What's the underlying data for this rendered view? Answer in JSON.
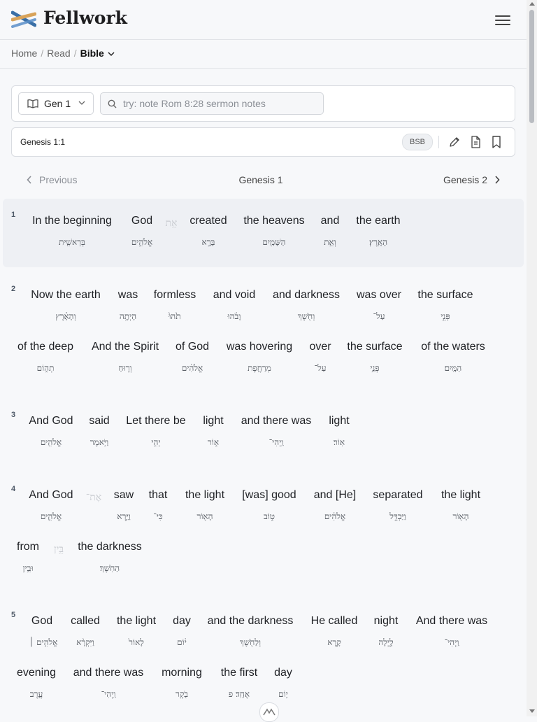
{
  "app": {
    "brand": "Fellwork"
  },
  "breadcrumb": {
    "home": "Home",
    "sep1": "/",
    "read": "Read",
    "sep2": "/",
    "current": "Bible"
  },
  "toolbar": {
    "book_selector": "Gen 1",
    "search_placeholder": "try: note Rom 8:28 sermon notes",
    "search_value": ""
  },
  "refbar": {
    "reference": "Genesis 1:1",
    "translation": "BSB"
  },
  "nav": {
    "previous": "Previous",
    "current": "Genesis 1",
    "next": "Genesis 2"
  },
  "verses": [
    {
      "num": "1",
      "words": [
        {
          "en": "In the beginning",
          "he": "בְּרֵאשִׁ֖ית"
        },
        {
          "en": "God",
          "he": "אֱלֹהִ֑ים"
        },
        {
          "en": "",
          "he": "אֵ֥ת"
        },
        {
          "en": "created",
          "he": "בָּרָ֣א"
        },
        {
          "en": "the heavens",
          "he": "הַשָּׁמַ֖יִם"
        },
        {
          "en": "and",
          "he": "וְאֵ֥ת"
        },
        {
          "en": "the earth",
          "he": "הָאָֽרֶץ׃"
        }
      ]
    },
    {
      "num": "2",
      "words": [
        {
          "en": "Now the earth",
          "he": "וְהָאָ֗רֶץ"
        },
        {
          "en": "was",
          "he": "הָיְתָ֥ה"
        },
        {
          "en": "formless",
          "he": "תֹ֙הוּ֙"
        },
        {
          "en": "and void",
          "he": "וָבֹ֔הוּ"
        },
        {
          "en": "and darkness",
          "he": "וְחֹ֖שֶׁךְ"
        },
        {
          "en": "was over",
          "he": "עַל־"
        },
        {
          "en": "the surface",
          "he": "פְּנֵ֣י"
        },
        {
          "en": "of the deep",
          "he": "תְה֑וֹם"
        },
        {
          "en": "And the Spirit",
          "he": "וְר֣וּחַ"
        },
        {
          "en": "of God",
          "he": "אֱלֹהִ֔ים"
        },
        {
          "en": "was hovering",
          "he": "מְרַחֶ֖פֶת"
        },
        {
          "en": "over",
          "he": "עַל־"
        },
        {
          "en": "the surface",
          "he": "פְּנֵ֥י"
        },
        {
          "en": "of the waters",
          "he": "הַמָּֽיִם׃"
        }
      ]
    },
    {
      "num": "3",
      "words": [
        {
          "en": "And God",
          "he": "אֱלֹהִ֖ים"
        },
        {
          "en": "said",
          "he": "וַיֹּ֥אמֶר"
        },
        {
          "en": "Let there be",
          "he": "יְהִ֣י"
        },
        {
          "en": "light",
          "he": "א֑וֹר"
        },
        {
          "en": "and there was",
          "he": "וַֽיְהִי־"
        },
        {
          "en": "light",
          "he": "אֽוֹר׃"
        }
      ]
    },
    {
      "num": "4",
      "words": [
        {
          "en": "And God",
          "he": "אֱלֹהִ֛ים"
        },
        {
          "en": "",
          "he": "אֶת־"
        },
        {
          "en": "saw",
          "he": "וַיַּ֧רְא"
        },
        {
          "en": "that",
          "he": "כִּי־"
        },
        {
          "en": "the light",
          "he": "הָא֖וֹר"
        },
        {
          "en": "[was] good",
          "he": "ט֑וֹב"
        },
        {
          "en": "and [He]",
          "he": "אֱלֹהִ֔ים"
        },
        {
          "en": "separated",
          "he": "וַיַּבְדֵּ֣ל"
        },
        {
          "en": "the light",
          "he": "הָא֖וֹר"
        },
        {
          "en": "from",
          "he": "וּבֵ֥ין"
        },
        {
          "en": "",
          "he": "בֵּ֥ין"
        },
        {
          "en": "the darkness",
          "he": "הַחֹֽשֶׁךְ׃"
        }
      ]
    },
    {
      "num": "5",
      "words": [
        {
          "en": "God",
          "he": "אֱלֹהִ֤ים ׀"
        },
        {
          "en": "called",
          "he": "וַיִּקְרָ֨א"
        },
        {
          "en": "the light",
          "he": "לָאוֹר֙"
        },
        {
          "en": "day",
          "he": "י֔וֹם"
        },
        {
          "en": "and the darkness",
          "he": "וְלַחֹ֖שֶׁךְ"
        },
        {
          "en": "He called",
          "he": "קָ֣רָא"
        },
        {
          "en": "night",
          "he": "לָ֑יְלָה"
        },
        {
          "en": "And there was",
          "he": "וַֽיְהִי־"
        },
        {
          "en": "evening",
          "he": "עֶ֥רֶב"
        },
        {
          "en": "and there was",
          "he": "וַֽיְהִי־"
        },
        {
          "en": "morning",
          "he": "בֹ֖קֶר"
        },
        {
          "en": "the first",
          "he": "אֶחָֽד׃ פ"
        },
        {
          "en": "day",
          "he": "י֥וֹם"
        }
      ]
    }
  ]
}
